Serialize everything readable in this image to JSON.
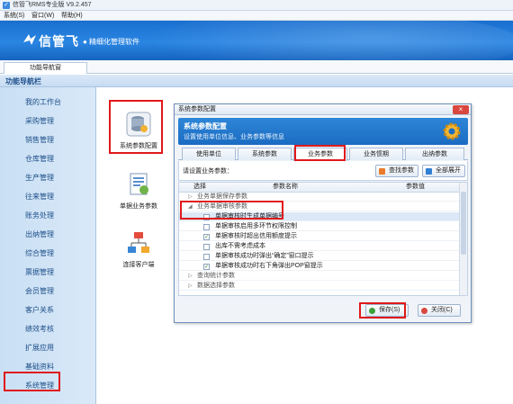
{
  "window": {
    "title": "信管飞RMS专业版 V9.2.457"
  },
  "menu": [
    "系统(S)",
    "窗口(W)",
    "帮助(H)"
  ],
  "banner": {
    "brand": "信管飞",
    "slogan": "● 精细化管理软件"
  },
  "tabs": [
    "功能导航窗"
  ],
  "nav_header": "功能导航栏",
  "sidebar": [
    "我的工作台",
    "采购管理",
    "销售管理",
    "仓库管理",
    "生产管理",
    "往来管理",
    "账务处理",
    "出纳管理",
    "综合管理",
    "票据管理",
    "会员管理",
    "客户关系",
    "绩效考核",
    "扩展应用",
    "基础资料",
    "系统管理"
  ],
  "functions": [
    "系统参数配置",
    "单据业务参数",
    "连接客户端"
  ],
  "dialog": {
    "title": "系统参数配置",
    "close": "×",
    "header_title": "系统参数配置",
    "header_desc": "设置使用单位信息、业务参数等信息",
    "tabs": [
      "使用单位",
      "系统参数",
      "业务参数",
      "业务惯期",
      "出纳参数"
    ],
    "prompt": "请设置业务参数：",
    "btn_find": "查找参数",
    "btn_expand": "全部展开",
    "col_select": "选择",
    "col_name": "参数名称",
    "col_value": "参数值",
    "rows": [
      {
        "type": "group",
        "open": false,
        "text": "业务单据保存参数"
      },
      {
        "type": "group",
        "open": true,
        "text": "业务单据审核参数"
      },
      {
        "type": "item",
        "checked": false,
        "text": "单据审核时生成单据编号",
        "selected": true
      },
      {
        "type": "item",
        "checked": false,
        "text": "单据审核启用多环节权限控制"
      },
      {
        "type": "item",
        "checked": true,
        "text": "单据审核时超出信用额度提示"
      },
      {
        "type": "item",
        "checked": false,
        "text": "出库不需考虑成本"
      },
      {
        "type": "item",
        "checked": false,
        "text": "单据审核成功时弹出“确定”窗口提示"
      },
      {
        "type": "item",
        "checked": true,
        "text": "单据审核成功时右下角弹出POP窗提示"
      },
      {
        "type": "group",
        "open": false,
        "text": "查询统计参数"
      },
      {
        "type": "group",
        "open": false,
        "text": "数据选择参数"
      }
    ],
    "btn_save": "保存(S)",
    "btn_close": "关闭(C)"
  },
  "colors": {
    "accent": "#1b6cc2",
    "highlight": "#e0191b"
  }
}
